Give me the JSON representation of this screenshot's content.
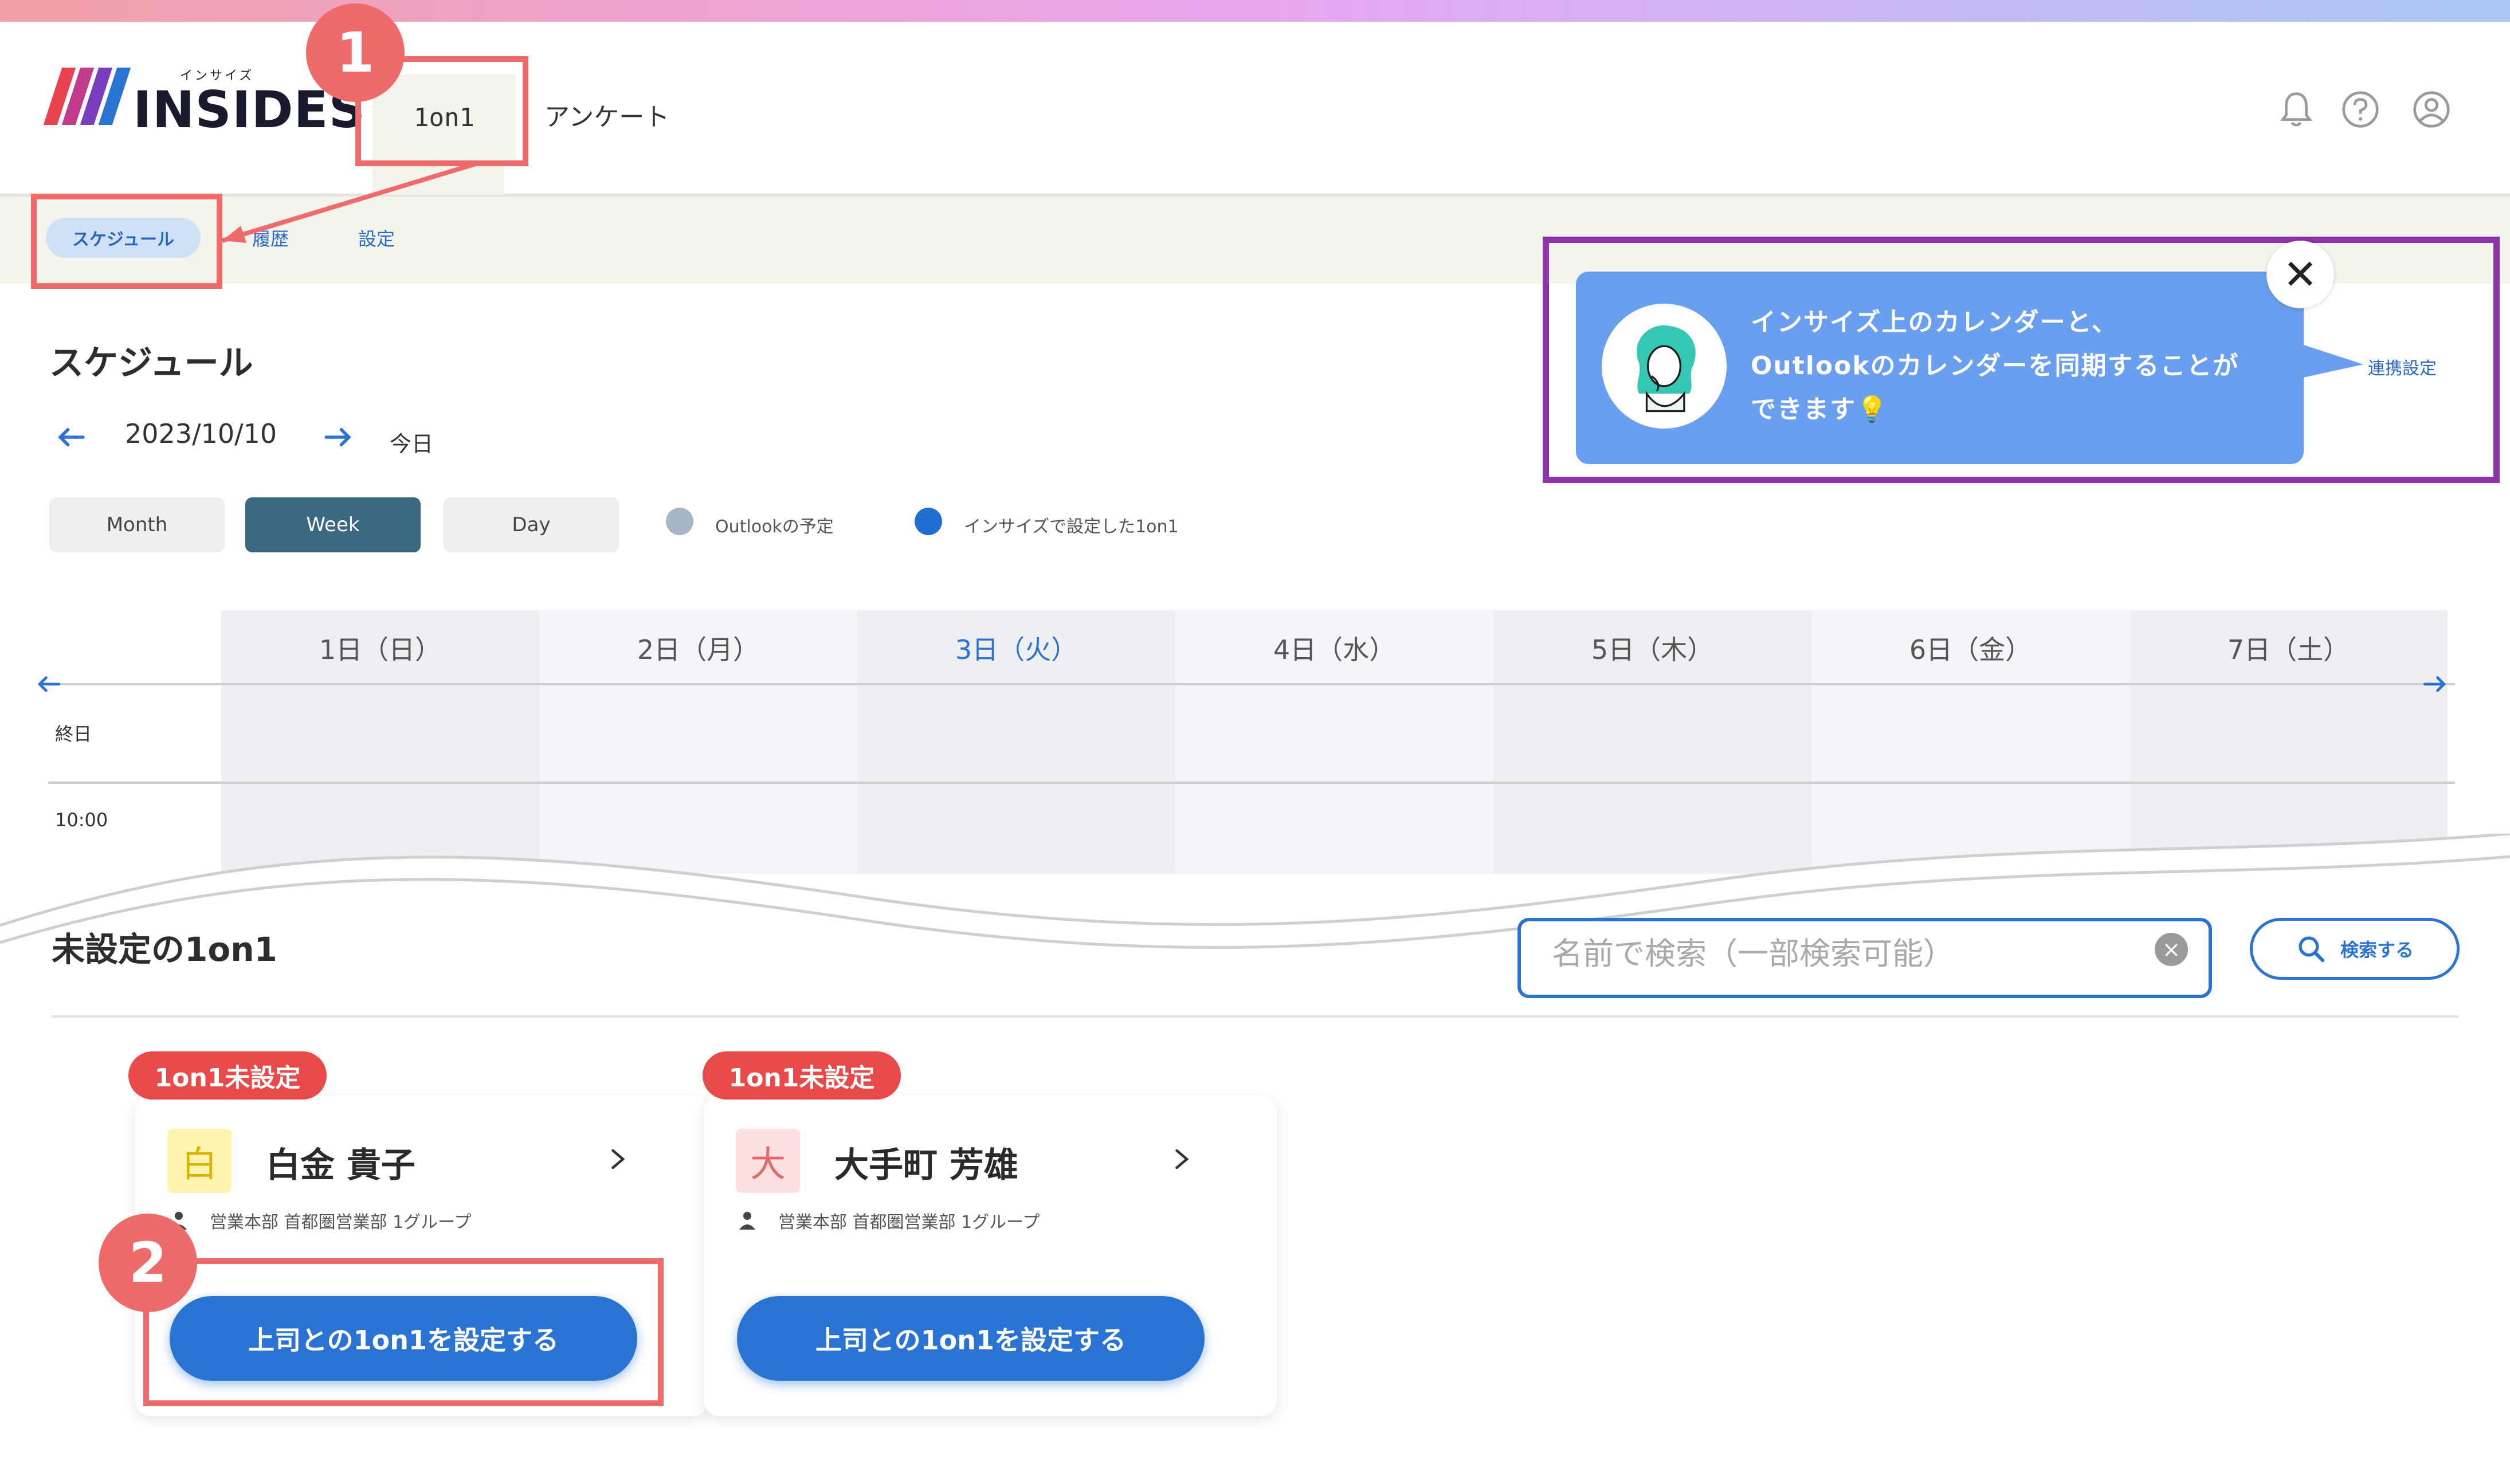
{
  "brand": {
    "kana": "インサイズ",
    "name": "INSIDES",
    "colors": [
      "#e8434f",
      "#7a3dbd",
      "#2a73d2"
    ]
  },
  "nav": {
    "tabs": [
      {
        "label": "1on1",
        "active": true
      },
      {
        "label": "アンケート",
        "active": false
      }
    ],
    "icons": [
      "bell-icon",
      "help-icon",
      "account-icon"
    ]
  },
  "subnav": {
    "items": [
      {
        "label": "スケジュール",
        "active": true
      },
      {
        "label": "履歴",
        "active": false
      },
      {
        "label": "設定",
        "active": false
      }
    ]
  },
  "schedule": {
    "title": "スケジュール",
    "date": "2023/10/10",
    "today_label": "今日",
    "views": [
      {
        "label": "Month",
        "active": false
      },
      {
        "label": "Week",
        "active": true
      },
      {
        "label": "Day",
        "active": false
      }
    ],
    "legend": [
      {
        "label": "Outlookの予定",
        "color": "#a5b6c9"
      },
      {
        "label": "インサイズで設定した1on1",
        "color": "#1f6fd1"
      }
    ],
    "days": [
      {
        "label": "1日（日）",
        "today": false
      },
      {
        "label": "2日（月）",
        "today": false
      },
      {
        "label": "3日（火）",
        "today": true
      },
      {
        "label": "4日（水）",
        "today": false
      },
      {
        "label": "5日（木）",
        "today": false
      },
      {
        "label": "6日（金）",
        "today": false
      },
      {
        "label": "7日（土）",
        "today": false
      }
    ],
    "rows": [
      "終日",
      "10:00"
    ]
  },
  "tooltip": {
    "message": "インサイズ上のカレンダーと、\nOutlookのカレンダーを同期することが\nできます💡",
    "link_label": "連携設定",
    "close_label": "✕"
  },
  "unset": {
    "title": "未設定の1on1",
    "search": {
      "placeholder": "名前で検索（一部検索可能）",
      "button_label": "検索する",
      "clear_label": "×"
    },
    "cards": [
      {
        "badge": "1on1未設定",
        "initial": "白",
        "name": "白金 貴子",
        "dept": "営業本部 首都圏営業部 1グループ",
        "button": "上司との1on1を設定する",
        "icon_bg": "#fff3b0",
        "icon_fg": "#d6b400"
      },
      {
        "badge": "1on1未設定",
        "initial": "大",
        "name": "大手町 芳雄",
        "dept": "営業本部 首都圏営業部 1グループ",
        "button": "上司との1on1を設定する",
        "icon_bg": "#fde0e0",
        "icon_fg": "#e06a6a"
      }
    ]
  },
  "annotations": {
    "step1": "1",
    "step2": "2"
  }
}
